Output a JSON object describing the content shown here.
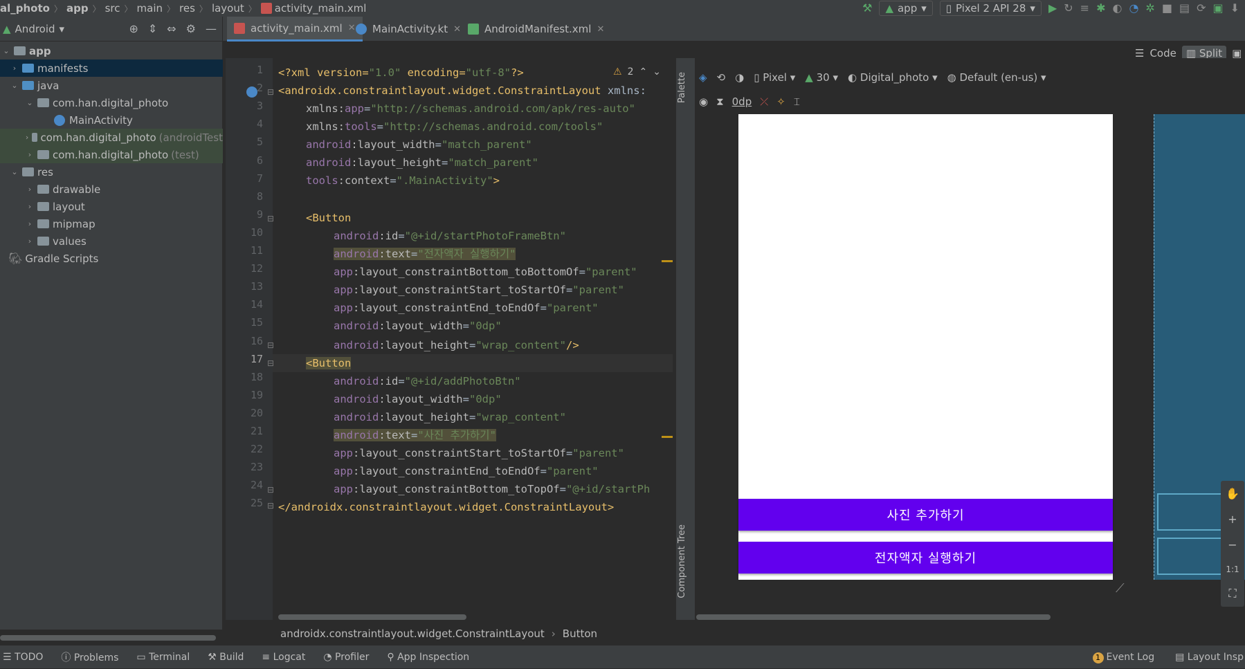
{
  "breadcrumb": [
    "al_photo",
    "app",
    "src",
    "main",
    "res",
    "layout",
    "activity_main.xml"
  ],
  "run_config": {
    "app": "app",
    "device": "Pixel 2 API 28"
  },
  "project_view": {
    "mode": "Android"
  },
  "tabs": [
    {
      "label": "activity_main.xml"
    },
    {
      "label": "MainActivity.kt"
    },
    {
      "label": "AndroidManifest.xml"
    }
  ],
  "tree": [
    {
      "label": "app",
      "hint": ""
    },
    {
      "label": "manifests",
      "hint": ""
    },
    {
      "label": "java",
      "hint": ""
    },
    {
      "label": "com.han.digital_photo",
      "hint": ""
    },
    {
      "label": "MainActivity",
      "hint": ""
    },
    {
      "label": "com.han.digital_photo",
      "hint": "(androidTest"
    },
    {
      "label": "com.han.digital_photo",
      "hint": "(test)"
    },
    {
      "label": "res",
      "hint": ""
    },
    {
      "label": "drawable",
      "hint": ""
    },
    {
      "label": "layout",
      "hint": ""
    },
    {
      "label": "mipmap",
      "hint": ""
    },
    {
      "label": "values",
      "hint": ""
    },
    {
      "label": "Gradle Scripts",
      "hint": ""
    }
  ],
  "line_numbers": [
    "1",
    "2",
    "3",
    "4",
    "5",
    "6",
    "7",
    "8",
    "9",
    "10",
    "11",
    "12",
    "13",
    "14",
    "15",
    "16",
    "17",
    "18",
    "19",
    "20",
    "21",
    "22",
    "23",
    "24",
    "25"
  ],
  "code": {
    "l1": {
      "a": "<?xml version=",
      "b": "\"1.0\"",
      "c": " encoding=",
      "d": "\"utf-8\"",
      "e": "?>"
    },
    "l2": {
      "a": "<androidx.constraintlayout.widget.ConstraintLayout",
      "b": " xmlns:"
    },
    "l3": {
      "ns": "xmlns:",
      "at": "app",
      "eq": "=",
      "v": "\"http://schemas.android.com/apk/res-auto\""
    },
    "l4": {
      "ns": "xmlns:",
      "at": "tools",
      "eq": "=",
      "v": "\"http://schemas.android.com/tools\""
    },
    "l5": {
      "ns": "android",
      "at": ":layout_width",
      "eq": "=",
      "v": "\"match_parent\""
    },
    "l6": {
      "ns": "android",
      "at": ":layout_height",
      "eq": "=",
      "v": "\"match_parent\""
    },
    "l7": {
      "ns": "tools",
      "at": ":context",
      "eq": "=",
      "v": "\".MainActivity\"",
      "t": ">"
    },
    "l9": {
      "t": "<Button"
    },
    "l10": {
      "ns": "android",
      "at": ":id",
      "eq": "=",
      "v": "\"@+id/startPhotoFrameBtn\""
    },
    "l11": {
      "ns": "android",
      "at": ":text",
      "eq": "=",
      "v": "\"전자액자 실행하기\""
    },
    "l12": {
      "ns": "app",
      "at": ":layout_constraintBottom_toBottomOf",
      "eq": "=",
      "v": "\"parent\""
    },
    "l13": {
      "ns": "app",
      "at": ":layout_constraintStart_toStartOf",
      "eq": "=",
      "v": "\"parent\""
    },
    "l14": {
      "ns": "app",
      "at": ":layout_constraintEnd_toEndOf",
      "eq": "=",
      "v": "\"parent\""
    },
    "l15": {
      "ns": "android",
      "at": ":layout_width",
      "eq": "=",
      "v": "\"0dp\""
    },
    "l16": {
      "ns": "android",
      "at": ":layout_height",
      "eq": "=",
      "v": "\"wrap_content\"",
      "t": "/>"
    },
    "l17": {
      "t": "<Button"
    },
    "l18": {
      "ns": "android",
      "at": ":id",
      "eq": "=",
      "v": "\"@+id/addPhotoBtn\""
    },
    "l19": {
      "ns": "android",
      "at": ":layout_width",
      "eq": "=",
      "v": "\"0dp\""
    },
    "l20": {
      "ns": "android",
      "at": ":layout_height",
      "eq": "=",
      "v": "\"wrap_content\""
    },
    "l21": {
      "ns": "android",
      "at": ":text",
      "eq": "=",
      "v": "\"사진 추가하기\""
    },
    "l22": {
      "ns": "app",
      "at": ":layout_constraintStart_toStartOf",
      "eq": "=",
      "v": "\"parent\""
    },
    "l23": {
      "ns": "app",
      "at": ":layout_constraintEnd_toEndOf",
      "eq": "=",
      "v": "\"parent\""
    },
    "l24": {
      "ns": "app",
      "at": ":layout_constraintBottom_toTopOf",
      "eq": "=",
      "v": "\"@+id/startPh"
    },
    "l25": {
      "t": "</androidx.constraintlayout.widget.ConstraintLayout>"
    }
  },
  "warnings": {
    "count": "2"
  },
  "view_modes": {
    "code": "Code",
    "split": "Split"
  },
  "design_toolbar": {
    "device": "Pixel",
    "api": "30",
    "theme": "Digital_photo",
    "locale": "Default (en-us)",
    "margin": "0dp"
  },
  "side_panels": {
    "palette": "Palette",
    "component_tree": "Component Tree"
  },
  "phone_preview": {
    "add_photo": "사진 추가하기",
    "start_frame": "전자액자 실행하기",
    "button_color": "#6200ee"
  },
  "zoom": {
    "fit": "1:1"
  },
  "path_bar": [
    "androidx.constraintlayout.widget.ConstraintLayout",
    "Button"
  ],
  "statusbar": {
    "left": [
      "TODO",
      "Problems",
      "Terminal",
      "Build",
      "Logcat",
      "Profiler",
      "App Inspection"
    ],
    "right": [
      "Event Log",
      "Layout Insp"
    ],
    "event_badge": "1"
  }
}
